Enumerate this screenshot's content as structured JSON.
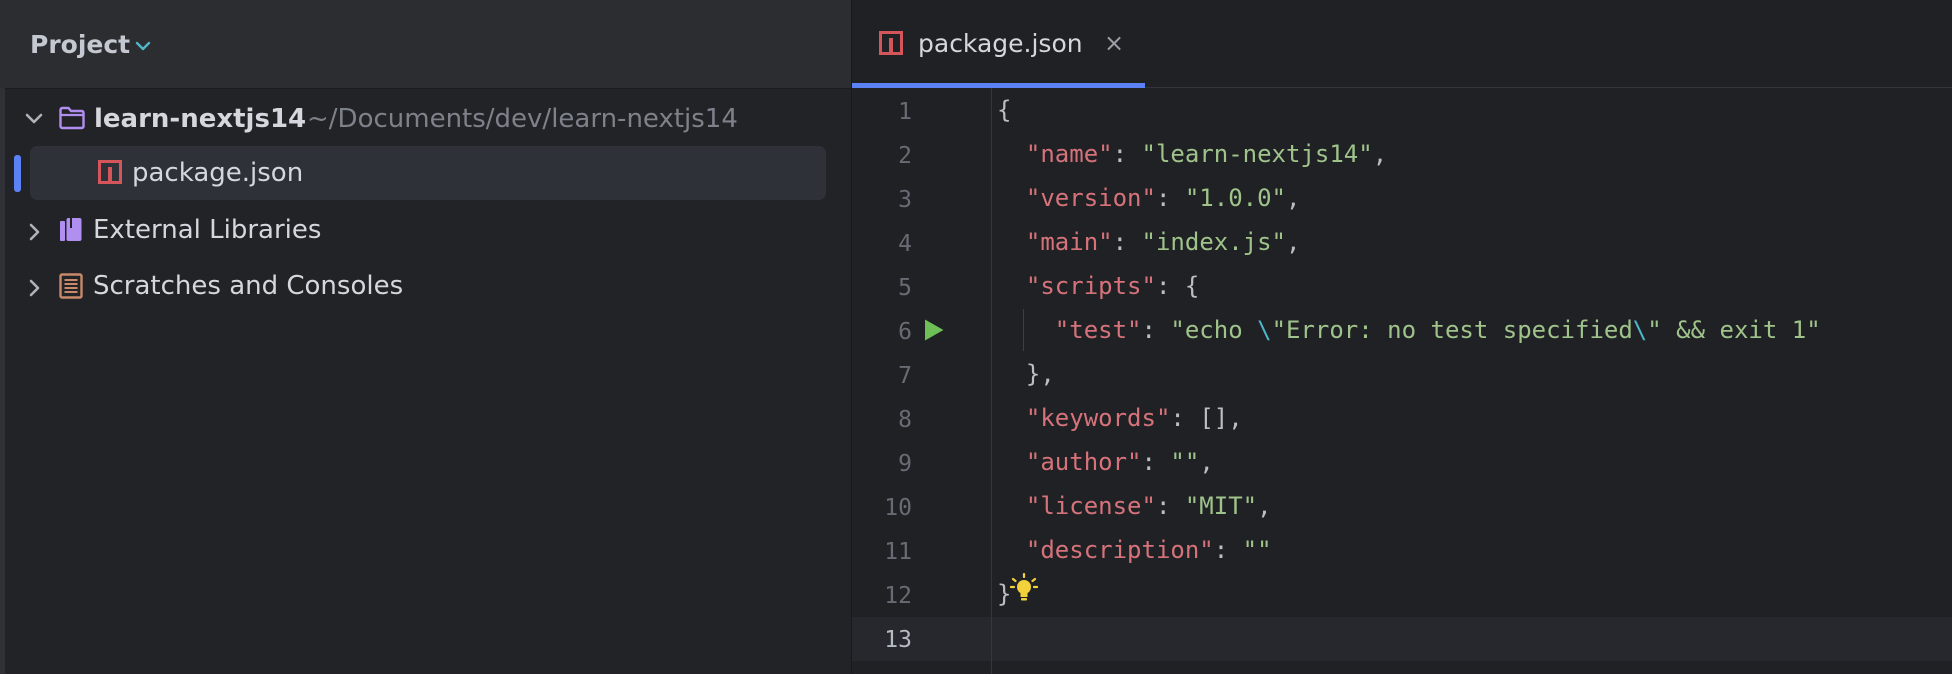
{
  "project_panel": {
    "title": "Project",
    "tree": {
      "root": {
        "name": "learn-nextjs14",
        "path": "~/Documents/dev/learn-nextjs14"
      },
      "file": {
        "name": "package.json"
      },
      "external_libraries": {
        "name": "External Libraries"
      },
      "scratches": {
        "name": "Scratches and Consoles"
      }
    }
  },
  "editor": {
    "tab": {
      "label": "package.json",
      "close": "×"
    },
    "active_line": 13,
    "line_numbers": [
      "1",
      "2",
      "3",
      "4",
      "5",
      "6",
      "7",
      "8",
      "9",
      "10",
      "11",
      "12",
      "13"
    ],
    "code": {
      "l1": {
        "open": "{"
      },
      "l2": {
        "key": "\"name\"",
        "sep": ": ",
        "value": "\"learn-nextjs14\"",
        "end": ","
      },
      "l3": {
        "key": "\"version\"",
        "sep": ": ",
        "value": "\"1.0.0\"",
        "end": ","
      },
      "l4": {
        "key": "\"main\"",
        "sep": ": ",
        "value": "\"index.js\"",
        "end": ","
      },
      "l5": {
        "key": "\"scripts\"",
        "sep": ": ",
        "end": "{"
      },
      "l6": {
        "key": "\"test\"",
        "sep": ": ",
        "v1": "\"echo ",
        "esc1": "\\",
        "v2": "\"Error: no test specified",
        "esc2": "\\",
        "v3": "\" && exit 1\""
      },
      "l7": {
        "close": "},"
      },
      "l8": {
        "key": "\"keywords\"",
        "sep": ": ",
        "end": "[],"
      },
      "l9": {
        "key": "\"author\"",
        "sep": ": ",
        "value": "\"\"",
        "end": ","
      },
      "l10": {
        "key": "\"license\"",
        "sep": ": ",
        "value": "\"MIT\"",
        "end": ","
      },
      "l11": {
        "key": "\"description\"",
        "sep": ": ",
        "value": "\"\""
      },
      "l12": {
        "close": "}"
      }
    }
  },
  "colors": {
    "accent": "#5a82f5",
    "json_key": "#d6737a",
    "json_string": "#9fc38a",
    "escape": "#4fb6c8",
    "run_gutter": "#6fbf57"
  },
  "icons": {
    "title_chevron": "chevron-down-icon",
    "expand_open": "chevron-down-icon",
    "expand_closed": "chevron-right-icon",
    "folder": "folder-icon",
    "npm_file": "npm-package-icon",
    "libraries": "library-icon",
    "scratches": "scratches-icon",
    "run": "run-gutter-icon",
    "intention": "lightbulb-icon"
  }
}
